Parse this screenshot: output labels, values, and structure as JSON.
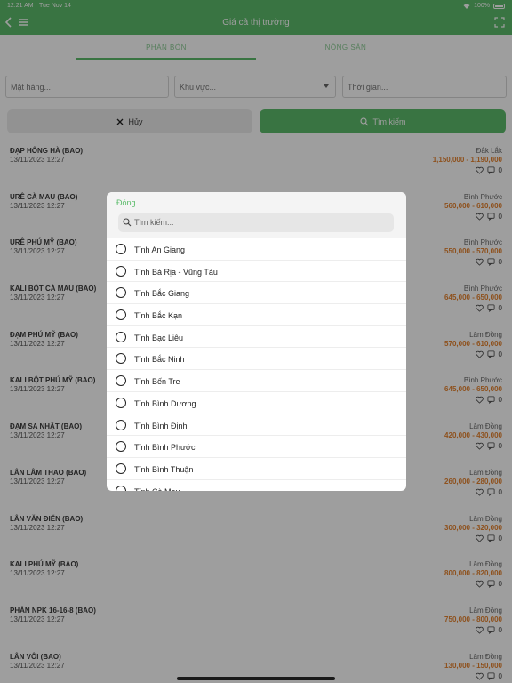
{
  "status": {
    "time": "12:21 AM",
    "date": "Tue Nov 14",
    "battery": "100%"
  },
  "header": {
    "title": "Giá cả thị trường"
  },
  "tabs": [
    {
      "label": "PHÂN BÓN"
    },
    {
      "label": "NÔNG SẢN"
    }
  ],
  "filters": {
    "item_placeholder": "Mặt hàng...",
    "region_placeholder": "Khu vực...",
    "time_placeholder": "Thời gian..."
  },
  "buttons": {
    "cancel": "Hủy",
    "search": "Tìm kiếm"
  },
  "list": [
    {
      "name": "ĐẠP HÔNG HÀ (BAO)",
      "date": "13/11/2023 12:27",
      "location": "Đắk Lắk",
      "price": "1,150,000 - 1,190,000",
      "comments": "0"
    },
    {
      "name": "URÊ CÀ MAU (BAO)",
      "date": "13/11/2023 12:27",
      "location": "Bình Phước",
      "price": "560,000 - 610,000",
      "comments": "0"
    },
    {
      "name": "URÊ PHÚ MỸ (BAO)",
      "date": "13/11/2023 12:27",
      "location": "Bình Phước",
      "price": "550,000 - 570,000",
      "comments": "0"
    },
    {
      "name": "KALI BỘT CÀ MAU (BAO)",
      "date": "13/11/2023 12:27",
      "location": "Bình Phước",
      "price": "645,000 - 650,000",
      "comments": "0"
    },
    {
      "name": "ĐẠM PHÚ MỸ (BAO)",
      "date": "13/11/2023 12:27",
      "location": "Lâm Đồng",
      "price": "570,000 - 610,000",
      "comments": "0"
    },
    {
      "name": "KALI BỘT PHÚ MỸ (BAO)",
      "date": "13/11/2023 12:27",
      "location": "Bình Phước",
      "price": "645,000 - 650,000",
      "comments": "0"
    },
    {
      "name": "ĐẠM SA NHẬT (BAO)",
      "date": "13/11/2023 12:27",
      "location": "Lâm Đồng",
      "price": "420,000 - 430,000",
      "comments": "0"
    },
    {
      "name": "LÂN LÂM THAO (BAO)",
      "date": "13/11/2023 12:27",
      "location": "Lâm Đồng",
      "price": "260,000 - 280,000",
      "comments": "0"
    },
    {
      "name": "LÂN VĂN ĐIỂN (BAO)",
      "date": "13/11/2023 12:27",
      "location": "Lâm Đồng",
      "price": "300,000 - 320,000",
      "comments": "0"
    },
    {
      "name": "KALI PHÚ MỸ (BAO)",
      "date": "13/11/2023 12:27",
      "location": "Lâm Đồng",
      "price": "800,000 - 820,000",
      "comments": "0"
    },
    {
      "name": "PHÂN NPK 16-16-8 (BAO)",
      "date": "13/11/2023 12:27",
      "location": "Lâm Đồng",
      "price": "750,000 - 800,000",
      "comments": "0"
    },
    {
      "name": "LÂN VÔI (BAO)",
      "date": "13/11/2023 12:27",
      "location": "Lâm Đồng",
      "price": "130,000 - 150,000",
      "comments": "0"
    }
  ],
  "modal": {
    "close_label": "Đóng",
    "search_placeholder": "Tìm kiếm...",
    "options": [
      "Tỉnh An Giang",
      "Tỉnh Bà Rịa - Vũng Tàu",
      "Tỉnh Bắc Giang",
      "Tỉnh Bắc Kạn",
      "Tỉnh Bạc Liêu",
      "Tỉnh Bắc Ninh",
      "Tỉnh Bến Tre",
      "Tỉnh Bình Dương",
      "Tỉnh Bình Định",
      "Tỉnh Bình Phước",
      "Tỉnh Bình Thuận",
      "Tỉnh Cà Mau"
    ]
  },
  "colors": {
    "accent": "#5cbc6b",
    "price": "#e5832f"
  }
}
